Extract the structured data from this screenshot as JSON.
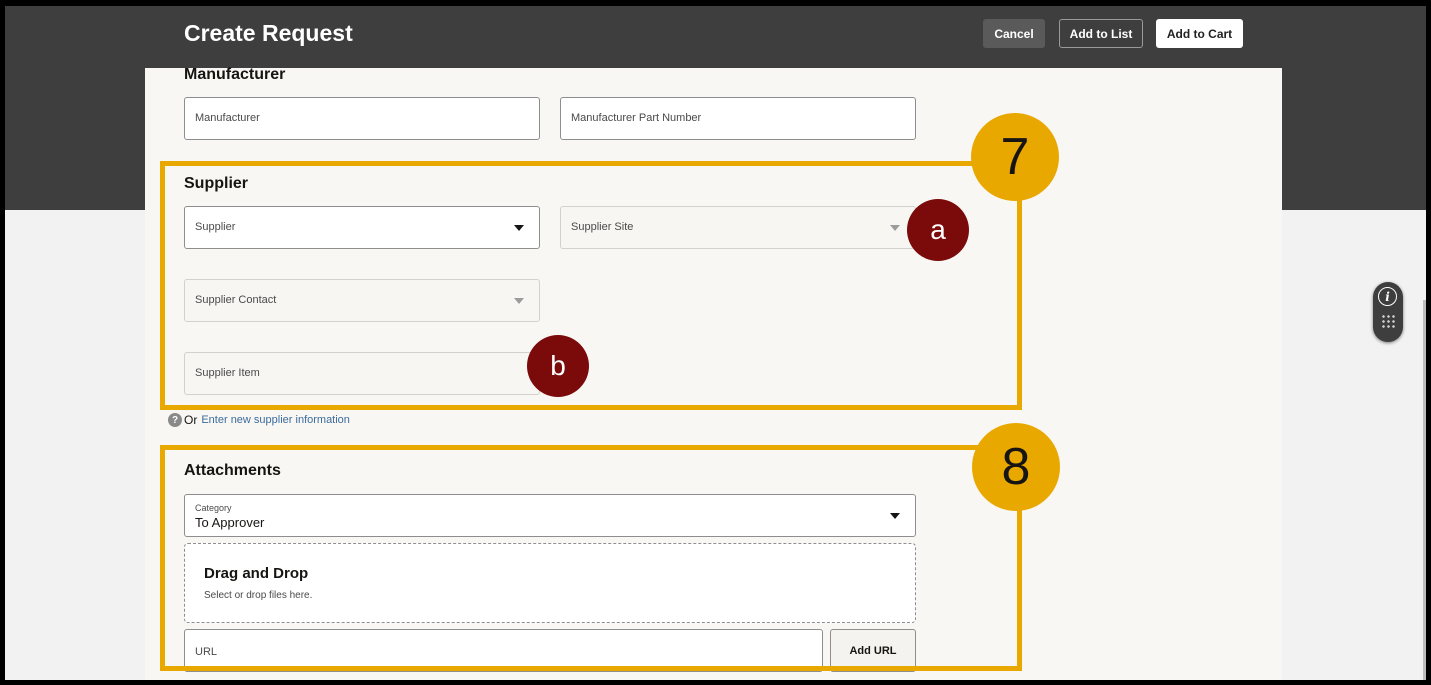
{
  "header": {
    "title": "Create Request",
    "cancel_label": "Cancel",
    "add_to_list_label": "Add to List",
    "add_to_cart_label": "Add to Cart"
  },
  "manufacturer": {
    "title": "Manufacturer",
    "manufacturer_placeholder": "Manufacturer",
    "part_number_placeholder": "Manufacturer Part Number"
  },
  "supplier": {
    "title": "Supplier",
    "supplier_placeholder": "Supplier",
    "supplier_site_placeholder": "Supplier Site",
    "supplier_contact_placeholder": "Supplier Contact",
    "supplier_item_placeholder": "Supplier Item",
    "help_icon": "?",
    "or_label": "Or",
    "new_supplier_link": "Enter new supplier information"
  },
  "attachments": {
    "title": "Attachments",
    "category_label": "Category",
    "category_value": "To Approver",
    "drop_title": "Drag and Drop",
    "drop_subtitle": "Select or drop files here.",
    "url_placeholder": "URL",
    "add_url_label": "Add URL"
  },
  "callouts": {
    "section_7": "7",
    "section_8": "8",
    "item_a": "a",
    "item_b": "b"
  },
  "side_widget": {
    "info_glyph": "i",
    "icons": [
      "info-icon",
      "grid-dots-icon"
    ]
  },
  "colors": {
    "header_bg": "#3e3e3e",
    "highlight": "#e9a800",
    "callout_dark": "#7b0b0b",
    "link": "#3a6b9c"
  }
}
